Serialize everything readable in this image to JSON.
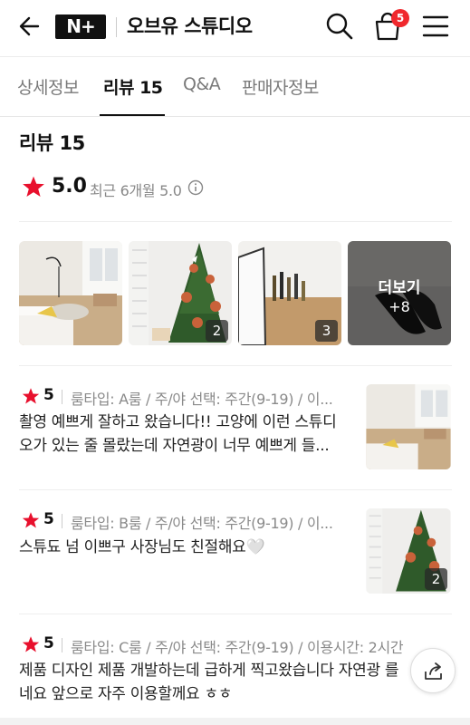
{
  "header": {
    "logo_text": "N+",
    "store_name": "오브유 스튜디오",
    "cart_count": "5"
  },
  "tabs": [
    {
      "label": "상세정보"
    },
    {
      "label": "리뷰 15"
    },
    {
      "label": "Q&A"
    },
    {
      "label": "판매자정보"
    }
  ],
  "review_section": {
    "title": "리뷰 15",
    "rating": "5.0",
    "recent_summary": "최근 6개월 5.0"
  },
  "photo_strip": {
    "counts": [
      "2",
      "3"
    ],
    "more_label": "더보기",
    "more_count": "+8"
  },
  "reviews": [
    {
      "score": "5",
      "meta": "룸타입: A룸 / 주/야 선택: 주간(9-19) / 이...",
      "text_line1": "촬영 예쁘게 잘하고 왔습니다!! 고양에 이런 스튜디",
      "text_line2": "오가 있는 줄 몰랐는데 자연광이 너무 예쁘게 들..."
    },
    {
      "score": "5",
      "meta": "룸타입: B룸 / 주/야 선택: 주간(9-19) / 이...",
      "text_line1": "스튜됴 넘 이쁘구 사장님도 친절해요🤍",
      "photo_count": "2"
    },
    {
      "score": "5",
      "meta": "룸타입: C룸 / 주/야 선택: 주간(9-19) / 이용시간: 2시간",
      "text_line1": "제품 디자인 제품 개발하는데 급하게 찍고왔습니다 자연광 를",
      "text_line2": "네요 앞으로 자주 이용할께요 ㅎㅎ"
    }
  ],
  "colors": {
    "accent_star": "#e8102d",
    "badge": "#f0282d"
  }
}
